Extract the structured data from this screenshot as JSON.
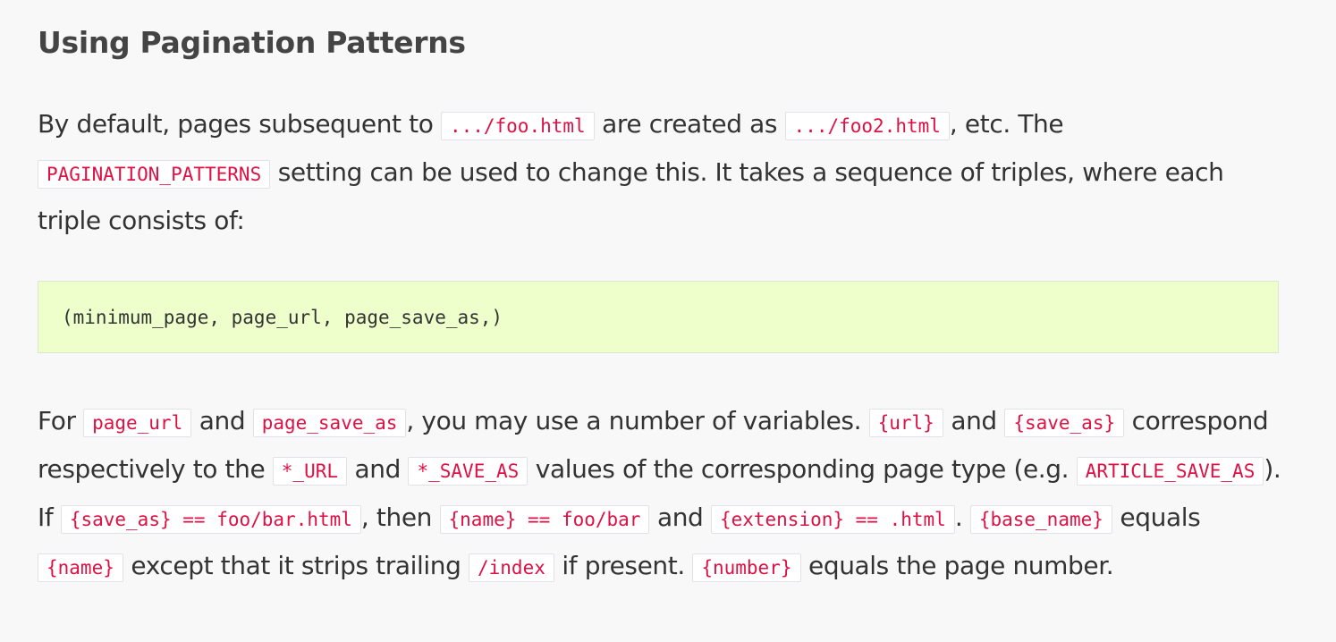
{
  "heading": "Using Pagination Patterns",
  "para1": {
    "t1": "By default, pages subsequent to ",
    "c1": ".../foo.html",
    "t2": " are created as ",
    "c2": ".../foo2.html",
    "t3": ", etc. The ",
    "c3": "PAGINATION_PATTERNS",
    "t4": " setting can be used to change this. It takes a sequence of triples, where each triple consists of:"
  },
  "code_block": "(minimum_page, page_url, page_save_as,)",
  "para2": {
    "t1": "For ",
    "c1": "page_url",
    "t2": " and ",
    "c2": "page_save_as",
    "t3": ", you may use a number of variables. ",
    "c3": "{url}",
    "t4": " and ",
    "c4": "{save_as}",
    "t5": " correspond respectively to the ",
    "c5": "*_URL",
    "t6": " and ",
    "c6": "*_SAVE_AS",
    "t7": " values of the corresponding page type (e.g. ",
    "c7": "ARTICLE_SAVE_AS",
    "t8": "). If ",
    "c8": "{save_as} == foo/bar.html",
    "t9": ", then ",
    "c9": "{name} == foo/bar",
    "t10": " and ",
    "c10": "{extension} == .html",
    "t11": ". ",
    "c11": "{base_name}",
    "t12": " equals ",
    "c12": "{name}",
    "t13": " except that it strips trailing ",
    "c13": "/index",
    "t14": " if present. ",
    "c14": "{number}",
    "t15": " equals the page number."
  },
  "colors": {
    "text": "#333333",
    "inline_code": "#dd1144",
    "code_block_bg": "#eeffcc",
    "page_bg": "#f8f8f8"
  }
}
